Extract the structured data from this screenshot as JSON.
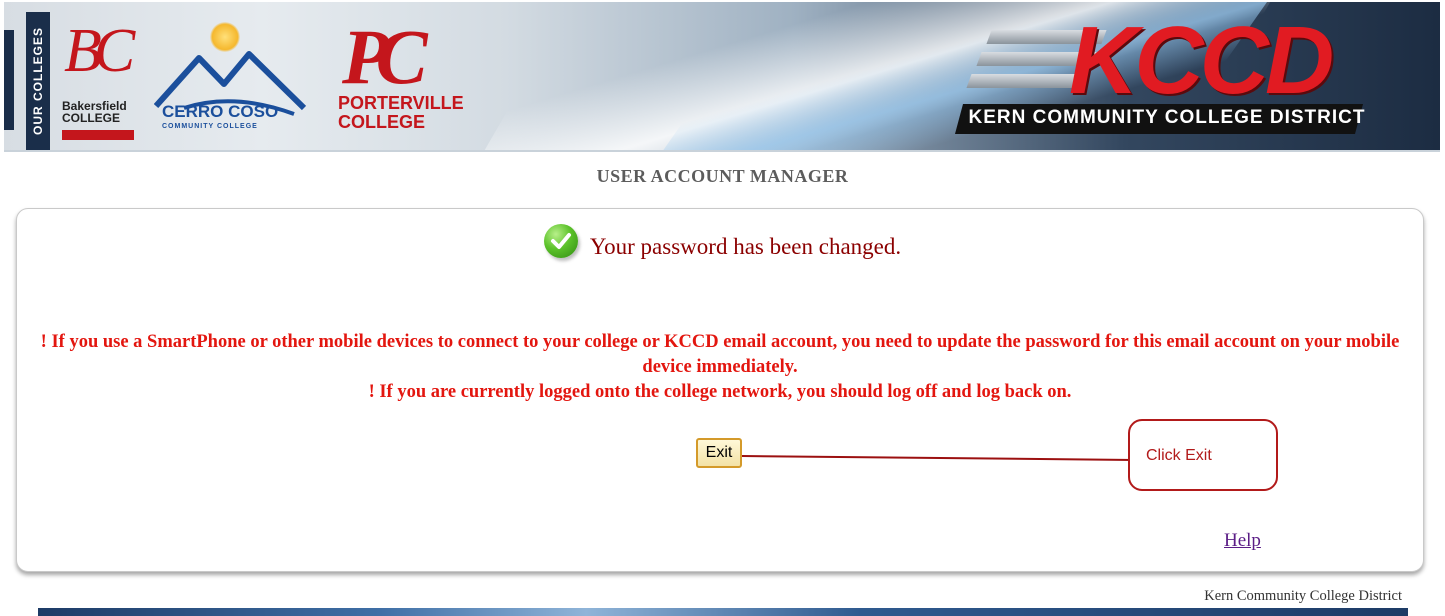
{
  "banner": {
    "sidebar_label": "OUR COLLEGES",
    "colleges": [
      {
        "mark": "BC",
        "name_line1": "Bakersfield",
        "name_line2": "COLLEGE"
      },
      {
        "name": "CERRO COSO",
        "sub": "COMMUNITY COLLEGE"
      },
      {
        "mark": "PC",
        "name_line1": "PORTERVILLE",
        "name_line2": "COLLEGE"
      }
    ],
    "district_logo": "KCCD",
    "district_name": "KERN COMMUNITY COLLEGE DISTRICT",
    "colors": {
      "college_red": "#c4161c",
      "cerro_blue": "#1b4f9c",
      "kccd_red": "#e11b22"
    }
  },
  "page_title": "USER ACCOUNT MANAGER",
  "main": {
    "success_icon": "check-circle-icon",
    "success_message": "Your password has been changed.",
    "warning_line1": "! If you use a SmartPhone or other mobile devices to connect to your college or KCCD email account, you need to update the password for this email account on your mobile device immediately.",
    "warning_line2": "! If you are currently logged onto the college network, you should log off and log back on.",
    "exit_label": "Exit",
    "callout_text": "Click Exit",
    "help_label": "Help"
  },
  "footer": {
    "text": "Kern Community College District"
  }
}
